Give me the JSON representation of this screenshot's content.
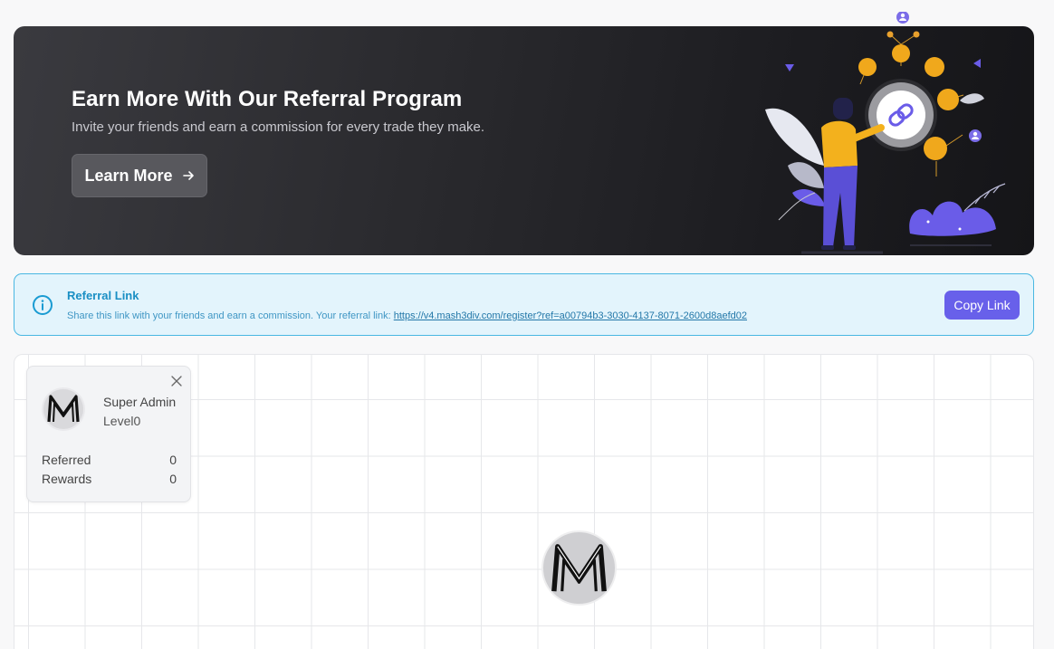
{
  "hero": {
    "title": "Earn More With Our Referral Program",
    "subtitle": "Invite your friends and earn a commission for every trade they make.",
    "button_label": "Learn More"
  },
  "referral": {
    "title": "Referral Link",
    "description": "Share this link with your friends and earn a commission. Your referral link:",
    "link": "https://v4.mash3div.com/register?ref=a00794b3-3030-4137-8071-2600d8aefd02",
    "copy_label": "Copy Link"
  },
  "profile_card": {
    "name": "Super Admin",
    "level": "Level0",
    "stats": [
      {
        "label": "Referred",
        "value": "0"
      },
      {
        "label": "Rewards",
        "value": "0"
      }
    ]
  },
  "icons": {
    "info": "info-circle-icon",
    "arrow": "arrow-right-icon",
    "close": "close-icon",
    "avatar": "m-logo-avatar"
  },
  "colors": {
    "accent": "#6860ea",
    "info_border": "#49b7e2",
    "info_bg": "#e3f4fc",
    "illustration_gold": "#f5a623",
    "illustration_purple": "#6a5ce8"
  }
}
